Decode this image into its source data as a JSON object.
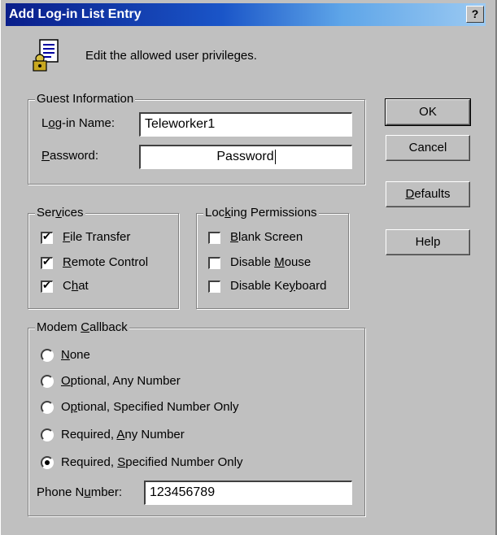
{
  "dialog": {
    "title": "Add Log-in List Entry",
    "help_label": "?",
    "header_text": "Edit the allowed user privileges."
  },
  "guest": {
    "group_title": "Guest Information",
    "login": {
      "prefix": "L",
      "accel": "o",
      "suffix": "g-in Name:",
      "value": "Teleworker1"
    },
    "password": {
      "prefix": "",
      "accel": "P",
      "suffix": "assword:",
      "value": "Password"
    }
  },
  "buttons": {
    "ok": "OK",
    "cancel": "Cancel",
    "defaults": {
      "accel": "D",
      "suffix": "efaults"
    },
    "help": "Help"
  },
  "services": {
    "group_title": {
      "prefix": "Ser",
      "accel": "v",
      "suffix": "ices"
    },
    "items": [
      {
        "prefix": "",
        "accel": "F",
        "suffix": "ile Transfer",
        "checked": true
      },
      {
        "prefix": "",
        "accel": "R",
        "suffix": "emote Control",
        "checked": true
      },
      {
        "prefix": "C",
        "accel": "h",
        "suffix": "at",
        "checked": true
      }
    ]
  },
  "locking": {
    "group_title": {
      "prefix": "Loc",
      "accel": "k",
      "suffix": "ing Permissions"
    },
    "items": [
      {
        "prefix": "",
        "accel": "B",
        "suffix": "lank Screen",
        "checked": false
      },
      {
        "prefix": "Disable ",
        "accel": "M",
        "suffix": "ouse",
        "checked": false
      },
      {
        "prefix": "Disable Ke",
        "accel": "y",
        "suffix": "board",
        "checked": false
      }
    ]
  },
  "callback": {
    "group_title": {
      "prefix": "Modem ",
      "accel": "C",
      "suffix": "allback"
    },
    "options": [
      {
        "prefix": "",
        "accel": "N",
        "suffix": "one",
        "selected": false
      },
      {
        "prefix": "",
        "accel": "O",
        "suffix": "ptional, Any Number",
        "selected": false
      },
      {
        "prefix": "O",
        "accel": "p",
        "suffix": "tional, Specified Number Only",
        "selected": false
      },
      {
        "prefix": "Required, ",
        "accel": "A",
        "suffix": "ny Number",
        "selected": false
      },
      {
        "prefix": "Required, ",
        "accel": "S",
        "suffix": "pecified Number Only",
        "selected": true
      }
    ],
    "phone": {
      "prefix": "Phone N",
      "accel": "u",
      "suffix": "mber:",
      "value": "123456789"
    }
  },
  "icons": {
    "dialog_icon": "user-list-lock-icon",
    "check_mark": "check-icon"
  },
  "colors": {
    "title_bar_start": "#0a1e8a",
    "title_bar_end": "#9ccaf2",
    "dialog_bg": "#c0c0c0"
  }
}
